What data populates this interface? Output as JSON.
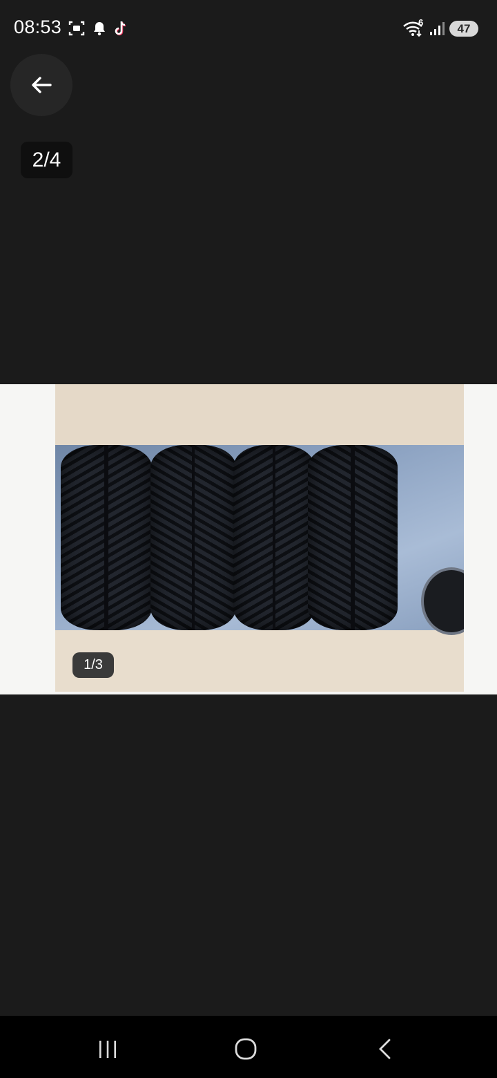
{
  "status_bar": {
    "time": "08:53",
    "battery": "47",
    "wifi_label": "6",
    "icons": [
      "screenshot-icon",
      "notification-bell-icon",
      "tiktok-icon",
      "wifi-icon",
      "signal-icon",
      "battery-icon"
    ]
  },
  "viewer": {
    "page_counter": "2/4",
    "back_icon": "arrow-left-icon"
  },
  "photo": {
    "image_counter": "1/3",
    "content": "four-tires-photo"
  },
  "nav_bar": {
    "icons": [
      "recent-apps-icon",
      "home-icon",
      "back-icon"
    ]
  }
}
